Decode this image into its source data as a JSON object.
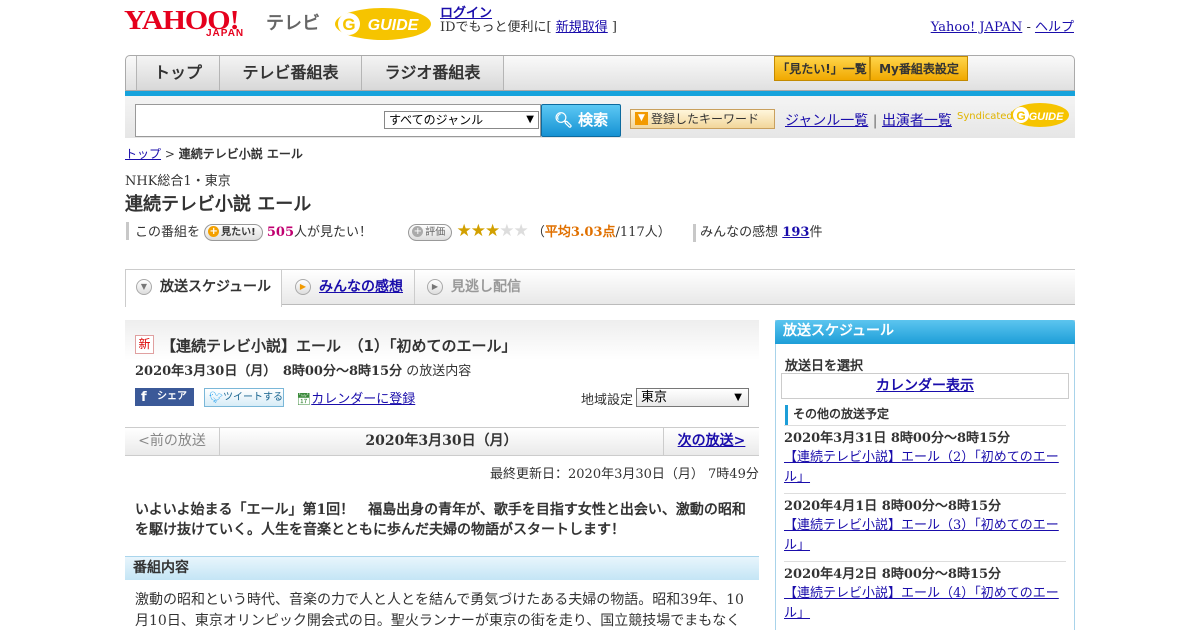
{
  "header": {
    "logo_yahoo": "YAHOO!",
    "logo_japan": "JAPAN",
    "logo_tv": "テレビ",
    "gguide_logo": "GUIDE",
    "login": "ログイン",
    "signup_prefix": "IDでもっと便利に[ ",
    "signup_link": "新規取得",
    "signup_suffix": " ]",
    "yj_link": "Yahoo! JAPAN",
    "yj_sep": " - ",
    "help_link": "ヘルプ"
  },
  "nav": {
    "top": "トップ",
    "tv": "テレビ番組表",
    "radio": "ラジオ番組表",
    "mitai_list": "「見たい!」一覧",
    "my_program": "My番組表設定"
  },
  "search": {
    "genre": "すべてのジャンル",
    "button": "検索",
    "keyword_btn": "登録したキーワード",
    "genre_list": "ジャンル一覧",
    "performer_list": "出演者一覧",
    "syndicated": "Syndicated"
  },
  "breadcrumb": {
    "top": "トップ",
    "sep": " > ",
    "current": "連続テレビ小説 エール"
  },
  "program": {
    "channel": "NHK総合1・東京",
    "title": "連続テレビ小説 エール",
    "want_prefix": "この番組を",
    "want_btn": "見たい!",
    "want_count": "505",
    "want_suffix": "人が見たい！",
    "rate_btn": "評価",
    "rating": 3,
    "rating_max": 5,
    "avg_prefix": "（",
    "avg": "平均3.03点",
    "avg_suffix": "/117人）",
    "impressions_label": "みんなの感想",
    "impressions_count": "193",
    "impressions_suffix": "件"
  },
  "tabs": {
    "schedule": "放送スケジュール",
    "impressions": "みんなの感想",
    "vod": "見逃し配信"
  },
  "episode": {
    "new_badge": "新",
    "title": "【連続テレビ小説】エール　（1）「初めてのエール」",
    "date": "2020年3月30日（月）　8時00分～8時15分",
    "date_suffix": "の放送内容",
    "share": "シェア",
    "tweet": "ツイートする",
    "calendar": "カレンダーに登録",
    "region_label": "地域設定",
    "region": "東京"
  },
  "pager": {
    "prev": "<前の放送",
    "date": "2020年3月30日（月）",
    "next": "次の放送>"
  },
  "updated": "最終更新日：2020年3月30日（月）  7時49分",
  "lead": "いよいよ始まる「エール」第1回！　福島出身の青年が、歌手を目指す女性と出会い、激動の昭和を駆け抜けていく。人生を音楽とともに歩んだ夫婦の物語がスタートします！",
  "section_head": "番組内容",
  "body": "激動の昭和という時代、音楽の力で人と人とを結んで勇気づけたある夫婦の物語。昭和39年、10月10日、東京オリンピック開会式の日。聖火ランナーが東京の街を走り、国立競技場でまもなく",
  "sidebar": {
    "head": "放送スケジュール",
    "select_date": "放送日を選択",
    "calendar": "カレンダー表示",
    "other": "その他の放送予定",
    "items": [
      {
        "time": "2020年3月31日  8時00分～8時15分",
        "title": "【連続テレビ小説】エール（2）「初めてのエール」"
      },
      {
        "time": "2020年4月1日  8時00分～8時15分",
        "title": "【連続テレビ小説】エール（3）「初めてのエール」"
      },
      {
        "time": "2020年4月2日  8時00分～8時15分",
        "title": "【連続テレビ小説】エール（4）「初めてのエール」"
      }
    ]
  },
  "colors": {
    "yahoo_red": "#e5001d",
    "accent_blue": "#17a3dc",
    "link": "#1a0dab",
    "star": "#d2a000"
  }
}
